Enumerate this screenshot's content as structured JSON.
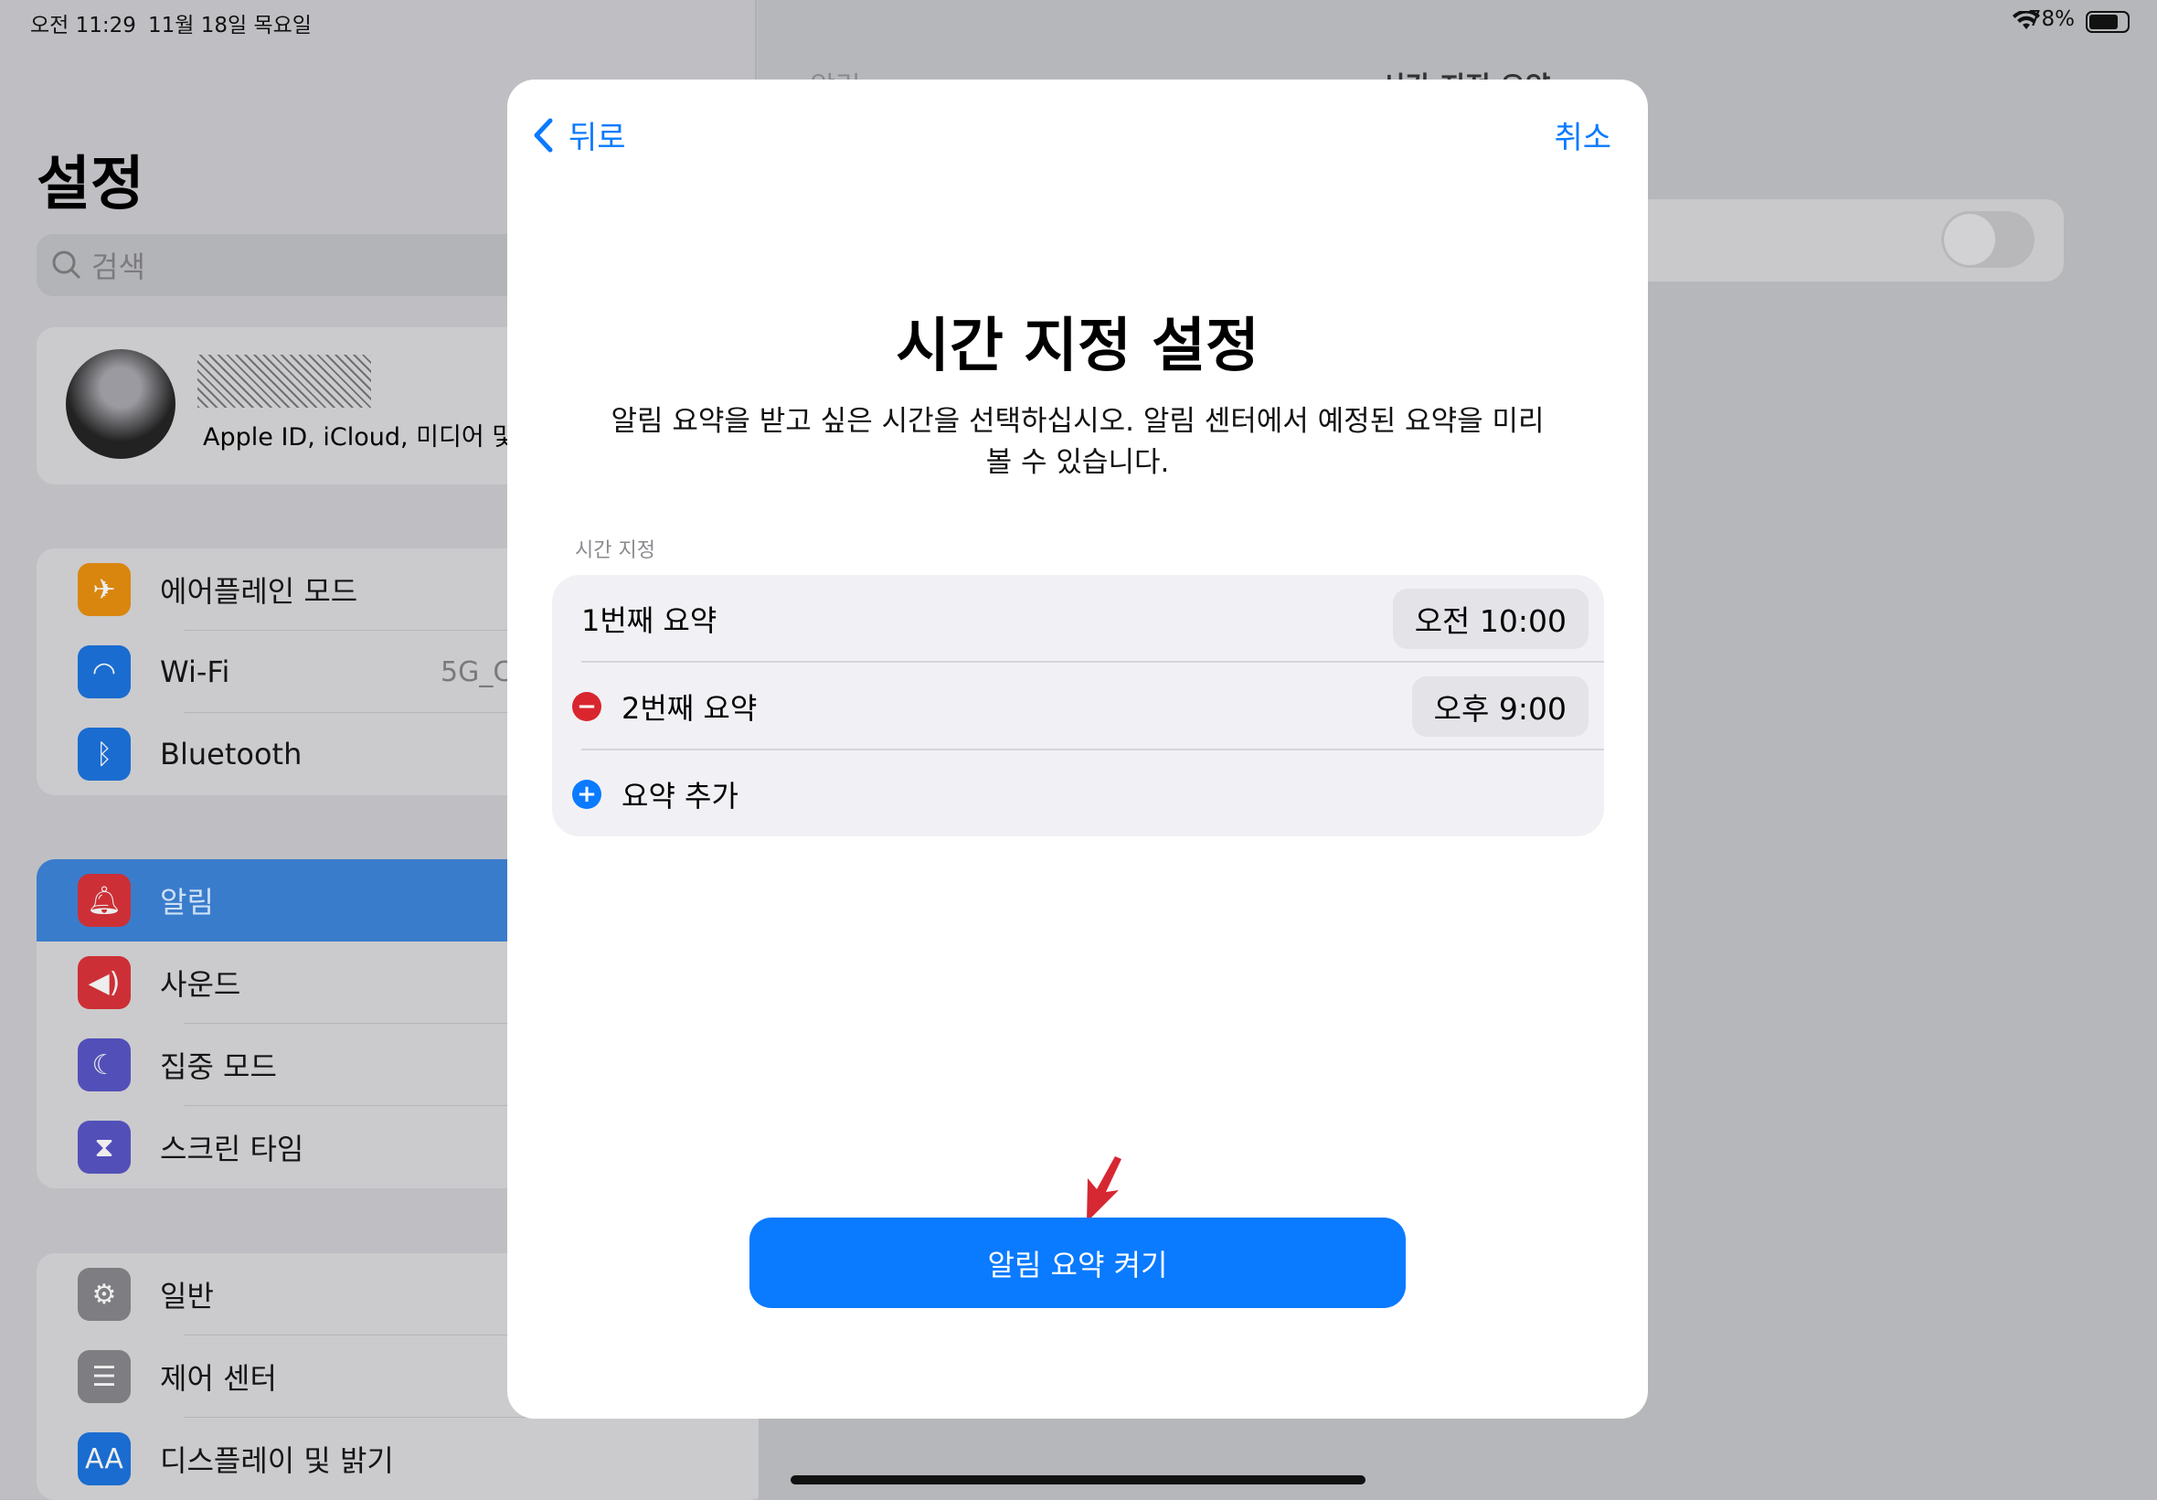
{
  "status_bar": {
    "time": "오전 11:29",
    "date": "11월 18일 목요일",
    "battery": "78%",
    "wifi_icon": "wifi-icon",
    "battery_icon": "battery-icon"
  },
  "sidebar": {
    "title": "설정",
    "search_placeholder": "검색",
    "profile": {
      "subtitle": "Apple ID, iCloud, 미디어 및 구"
    },
    "groups": [
      [
        {
          "label": "에어플레인 모드",
          "icon": "airplane-icon",
          "color": "#d9860f"
        },
        {
          "label": "Wi-Fi",
          "value": "5G_C",
          "icon": "wifi-icon",
          "color": "#1a6cd0"
        },
        {
          "label": "Bluetooth",
          "icon": "bluetooth-icon",
          "color": "#1a6cd0"
        }
      ],
      [
        {
          "label": "알림",
          "icon": "bell-icon",
          "color": "#cc3036",
          "selected": true
        },
        {
          "label": "사운드",
          "icon": "speaker-icon",
          "color": "#cc3036"
        },
        {
          "label": "집중 모드",
          "icon": "moon-icon",
          "color": "#5250b8"
        },
        {
          "label": "스크린 타임",
          "icon": "hourglass-icon",
          "color": "#5250b8"
        }
      ],
      [
        {
          "label": "일반",
          "icon": "gear-icon",
          "color": "#7d7d82"
        },
        {
          "label": "제어 센터",
          "icon": "toggles-icon",
          "color": "#7d7d82"
        },
        {
          "label": "디스플레이 및 밝기",
          "icon": "text-size-icon",
          "color": "#1a6cd0"
        }
      ]
    ]
  },
  "detail": {
    "back": "알림",
    "title": "시간 지정 요약",
    "toggle_on": false
  },
  "modal": {
    "back_label": "뒤로",
    "cancel_label": "취소",
    "title": "시간 지정 설정",
    "description": "알림 요약을 받고 싶은 시간을 선택하십시오. 알림 센터에서 예정된 요약을 미리 볼 수 있습니다.",
    "section_label": "시간 지정",
    "schedules": [
      {
        "label": "1번째 요약",
        "time": "오전 10:00"
      },
      {
        "label": "2번째 요약",
        "time": "오후 9:00"
      }
    ],
    "add_label": "요약 추가",
    "primary_button": "알림 요약 켜기",
    "accent": "#0a7aff"
  }
}
